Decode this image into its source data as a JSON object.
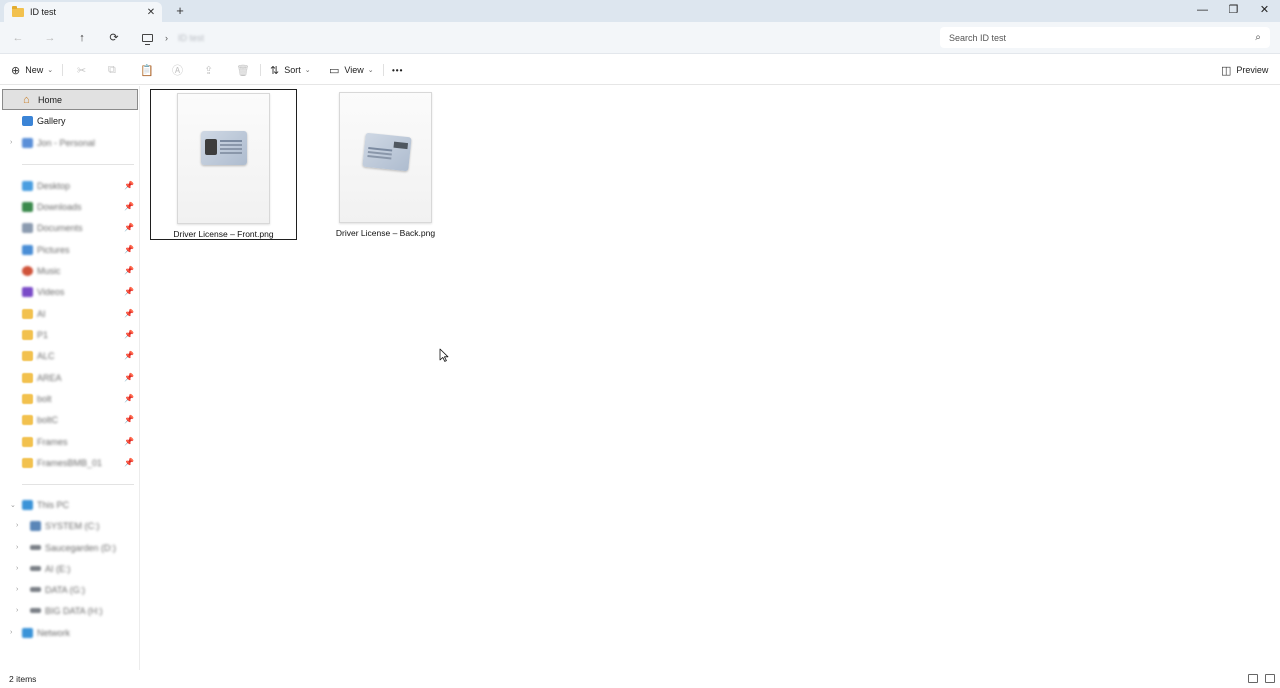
{
  "window": {
    "tab_title": "ID test",
    "tab_close": "✕",
    "new_tab": "+",
    "controls": {
      "minimize": "—",
      "maximize": "❐",
      "close": "✕"
    }
  },
  "address_bar": {
    "back": "←",
    "forward": "→",
    "up": "↑",
    "refresh": "⟳",
    "separator": "›",
    "breadcrumb": "ID test",
    "search_placeholder": "Search ID test",
    "search_icon": "⌕"
  },
  "commands": {
    "new": {
      "label": "New",
      "icon": "⊕"
    },
    "cut_icon": "✂",
    "copy_icon": "⧉",
    "paste_icon": "📋",
    "rename_icon": "Ⓐ",
    "share_icon": "⇪",
    "delete_icon": "🗑",
    "sort": {
      "label": "Sort",
      "icon": "⇅"
    },
    "view": {
      "label": "View",
      "icon": "▭"
    },
    "more": "•••",
    "preview": {
      "label": "Preview",
      "icon": "◫"
    },
    "dropdown_glyph": "⌄"
  },
  "sidebar": {
    "home": "Home",
    "gallery": "Gallery",
    "account": "Jon - Personal",
    "pinned": [
      "Desktop",
      "Downloads",
      "Documents",
      "Pictures",
      "Music",
      "Videos",
      "AI",
      "P1",
      "ALC",
      "AREA",
      "bolt",
      "boltC",
      "Frames",
      "FramesBMB_01"
    ],
    "pin_icon": "📌",
    "this_pc": "This PC",
    "drives": [
      "SYSTEM (C:)",
      "Saucegarden (D:)",
      "AI (E:)",
      "DATA (G:)",
      "BIG DATA (H:)"
    ],
    "network": "Network",
    "expand_glyph": "›",
    "expanded_glyph": "⌄"
  },
  "files": [
    {
      "name": "Driver License – Front.png",
      "selected": true
    },
    {
      "name": "Driver License – Back.png",
      "selected": false
    }
  ],
  "status": {
    "item_count": "2 items"
  },
  "colors": {
    "titlebar": "#dde6ef",
    "addressbar": "#f3f6f9",
    "selection": "#e1e1e1",
    "folder": "#f2c14e"
  }
}
